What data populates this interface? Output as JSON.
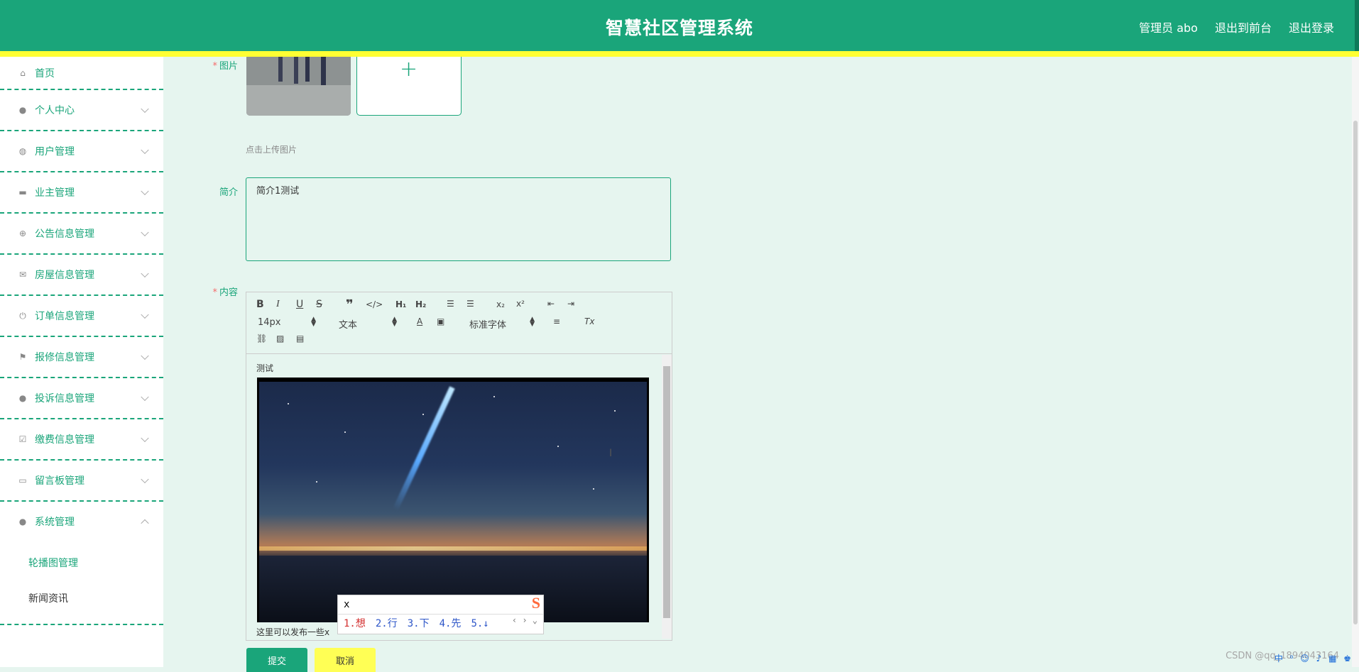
{
  "header": {
    "title": "智慧社区管理系统",
    "nav": [
      "管理员 abo",
      "退出到前台",
      "退出登录"
    ]
  },
  "sidebar": {
    "items": [
      {
        "label": "首页",
        "icon": "home-icon"
      },
      {
        "label": "个人中心",
        "icon": "user-icon"
      },
      {
        "label": "用户管理",
        "icon": "microphone-icon"
      },
      {
        "label": "业主管理",
        "icon": "brush-icon"
      },
      {
        "label": "公告信息管理",
        "icon": "target-icon"
      },
      {
        "label": "房屋信息管理",
        "icon": "mail-icon"
      },
      {
        "label": "订单信息管理",
        "icon": "power-icon"
      },
      {
        "label": "报修信息管理",
        "icon": "flag-icon"
      },
      {
        "label": "投诉信息管理",
        "icon": "location-icon"
      },
      {
        "label": "缴费信息管理",
        "icon": "checkbox-icon"
      },
      {
        "label": "留言板管理",
        "icon": "monitor-icon"
      },
      {
        "label": "系统管理",
        "icon": "user-icon"
      }
    ],
    "submenu": [
      "轮播图管理",
      "新闻资讯"
    ]
  },
  "form": {
    "image_label": "图片",
    "upload_hint": "点击上传图片",
    "intro_label": "简介",
    "intro_value": "简介1测试",
    "content_label": "内容",
    "editor": {
      "font_size": "14px",
      "block_format": "文本",
      "font_family": "标准字体",
      "text_top": "测试",
      "text_bottom": "这里可以发布一些x"
    },
    "submit_label": "提交",
    "cancel_label": "取消"
  },
  "ime": {
    "input": "x",
    "candidates": [
      "1.想",
      "2.行",
      "3.下",
      "4.先",
      "5.↓"
    ]
  },
  "watermark": "CSDN @qq_1894043164",
  "tray": "中 ⁰ ☺ ♪ ▦ ♚"
}
